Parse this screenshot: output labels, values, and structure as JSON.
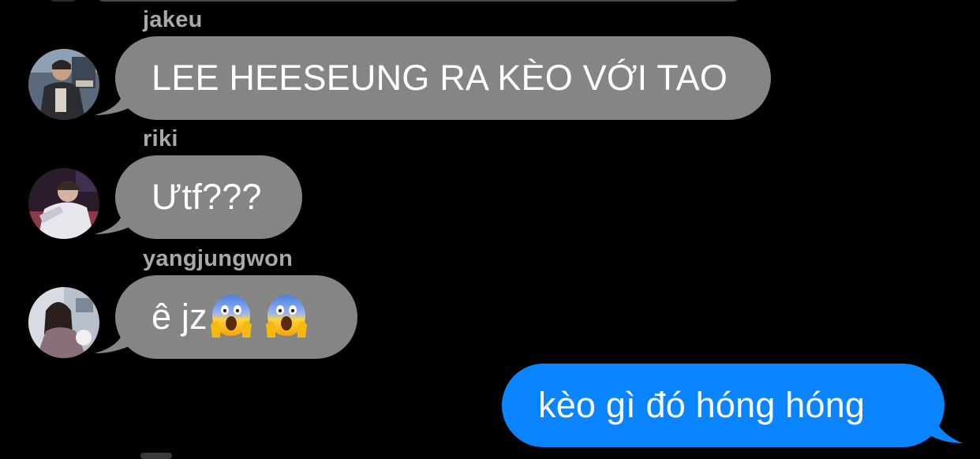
{
  "conversation": {
    "messages": [
      {
        "sender": "jakeu",
        "text": "LEE HEESEUNG RA KÈO VỚI TAO",
        "direction": "incoming"
      },
      {
        "sender": "riki",
        "text": "Ưtf???",
        "direction": "incoming"
      },
      {
        "sender": "yangjungwon",
        "text": "ê jz",
        "direction": "incoming",
        "emojis": [
          "face-screaming-in-fear-emoji",
          "face-screaming-in-fear-emoji"
        ]
      },
      {
        "text": "kèo gì đó hóng hóng",
        "direction": "outgoing"
      }
    ]
  },
  "colors": {
    "background": "#000000",
    "incoming_bubble": "#858585",
    "outgoing_bubble": "#0a84ff",
    "sender_name": "#a9a9a9",
    "text": "#ffffff"
  }
}
